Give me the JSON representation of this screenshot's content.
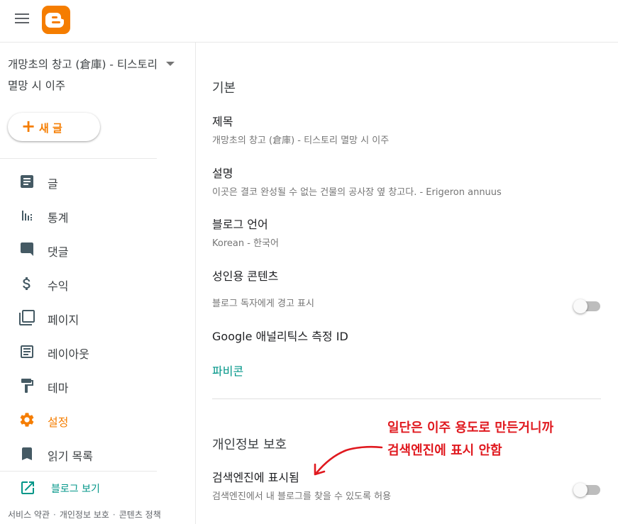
{
  "header": {
    "menu_icon": "hamburger-menu-icon",
    "logo_icon": "blogger-logo-icon",
    "brand_color": "#f57d00"
  },
  "sidebar": {
    "blog_title": "개망초의 창고 (倉庫) - 티스토리 멸망 시 이주",
    "new_post_label": "새 글",
    "nav": [
      {
        "label": "글",
        "icon": "posts-icon"
      },
      {
        "label": "통계",
        "icon": "stats-icon"
      },
      {
        "label": "댓글",
        "icon": "comments-icon"
      },
      {
        "label": "수익",
        "icon": "dollar-icon"
      },
      {
        "label": "페이지",
        "icon": "pages-icon"
      },
      {
        "label": "레이아웃",
        "icon": "layout-icon"
      },
      {
        "label": "테마",
        "icon": "paint-roller-icon"
      },
      {
        "label": "설정",
        "icon": "gear-icon",
        "active": true
      },
      {
        "label": "읽기 목록",
        "icon": "bookmark-icon"
      }
    ],
    "view_blog_label": "블로그 보기",
    "footer": {
      "terms": "서비스 약관",
      "privacy": "개인정보 보호",
      "content_policy": "콘텐츠 정책"
    }
  },
  "main": {
    "basic": {
      "section_title": "기본",
      "title": {
        "name": "제목",
        "value": "개망초의 창고 (倉庫) - 티스토리 멸망 시 이주"
      },
      "description": {
        "name": "설명",
        "value": "이곳은 결코 완성될 수 없는 건물의 공사장 옆 창고다. - Erigeron annuus"
      },
      "language": {
        "name": "블로그 언어",
        "value": "Korean - 한국어"
      },
      "adult_content": {
        "name": "성인용 콘텐츠",
        "desc": "블로그 독자에게 경고 표시",
        "enabled": false
      },
      "analytics": {
        "name": "Google 애널리틱스 측정 ID"
      },
      "favicon": {
        "name": "파비콘"
      }
    },
    "privacy": {
      "section_title": "개인정보 보호",
      "search_visible": {
        "name": "검색엔진에 표시됨",
        "desc": "검색엔진에서 내 블로그를 찾을 수 있도록 허용",
        "enabled": false
      }
    }
  },
  "annotation": {
    "line1": "일단은 이주 용도로 만든거니까",
    "line2": "검색엔진에 표시 안함",
    "color": "#e0191f"
  }
}
